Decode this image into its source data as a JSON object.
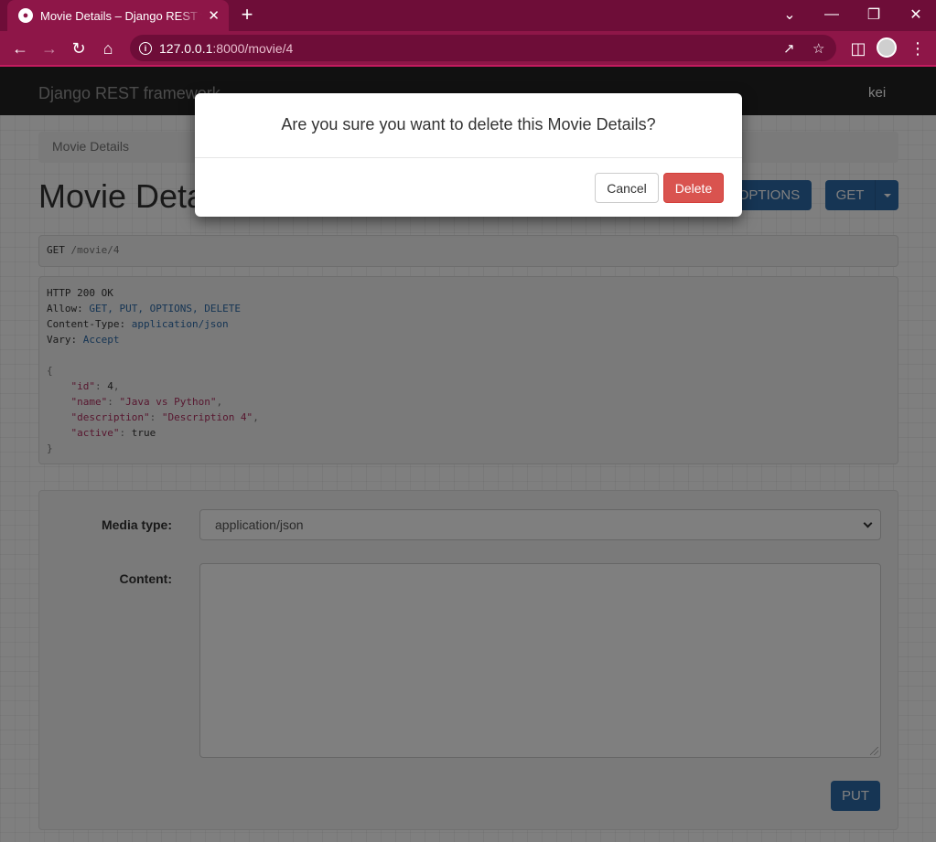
{
  "browser": {
    "tab_title": "Movie Details – Django REST framework",
    "url_host": "127.0.0.1",
    "url_rest": ":8000/movie/4",
    "icons": [
      "globe-icon",
      "close-icon",
      "plus-icon",
      "back-icon",
      "forward-icon",
      "reload-icon",
      "home-icon",
      "info-icon",
      "share-icon",
      "star-icon",
      "sidepanel-icon",
      "avatar",
      "menu-icon",
      "minimize-icon",
      "restore-icon",
      "window-close-icon"
    ]
  },
  "navbar": {
    "brand": "Django REST framework",
    "user": "kei"
  },
  "page": {
    "breadcrumb": "Movie Details",
    "title": "Movie Details",
    "options_label": "OPTIONS",
    "get_label": "GET",
    "request_method": "GET",
    "request_path": "/movie/4",
    "response": {
      "status": "HTTP 200 OK",
      "headers": [
        {
          "name": "Allow:",
          "value": "GET, PUT, OPTIONS, DELETE"
        },
        {
          "name": "Content-Type:",
          "value": "application/json"
        },
        {
          "name": "Vary:",
          "value": "Accept"
        }
      ],
      "body": {
        "open": "{",
        "id_key": "\"id\"",
        "id_val": "4",
        "name_key": "\"name\"",
        "name_val": "\"Java vs Python\"",
        "desc_key": "\"description\"",
        "desc_val": "\"Description 4\"",
        "active_key": "\"active\"",
        "active_val": "true",
        "close": "}"
      }
    },
    "form": {
      "media_type_label": "Media type:",
      "media_type_value": "application/json",
      "content_label": "Content:",
      "put_label": "PUT"
    }
  },
  "modal": {
    "title": "Are you sure you want to delete this Movie Details?",
    "cancel_label": "Cancel",
    "delete_label": "Delete"
  },
  "colors": {
    "chrome_dark": "#6e0d38",
    "chrome": "#8e1648",
    "primary": "#2c6aa8",
    "danger": "#d9534f"
  }
}
